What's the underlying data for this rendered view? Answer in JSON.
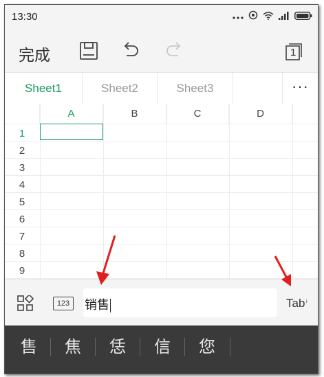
{
  "status_bar": {
    "time": "13:30"
  },
  "toolbar": {
    "done_label": "完成",
    "icons": [
      "save-icon",
      "undo-icon",
      "redo-icon",
      "sheet-count-icon"
    ],
    "sheet_count": "1"
  },
  "tabs": {
    "items": [
      "Sheet1",
      "Sheet2",
      "Sheet3"
    ],
    "more_label": "···"
  },
  "grid": {
    "columns": [
      "A",
      "B",
      "C",
      "D"
    ],
    "rows": [
      "1",
      "2",
      "3",
      "4",
      "5",
      "6",
      "7",
      "8",
      "9"
    ],
    "selected_cell": "A1"
  },
  "input_bar": {
    "numeric_label": "123",
    "text": "销售",
    "tab_label": "Tab"
  },
  "candidates": [
    "售",
    "焦",
    "恁",
    "信",
    "您"
  ],
  "colors": {
    "accent": "#1a9b5e",
    "annotation_arrow": "#e02020",
    "candidate_bar": "#3a3a3a"
  }
}
